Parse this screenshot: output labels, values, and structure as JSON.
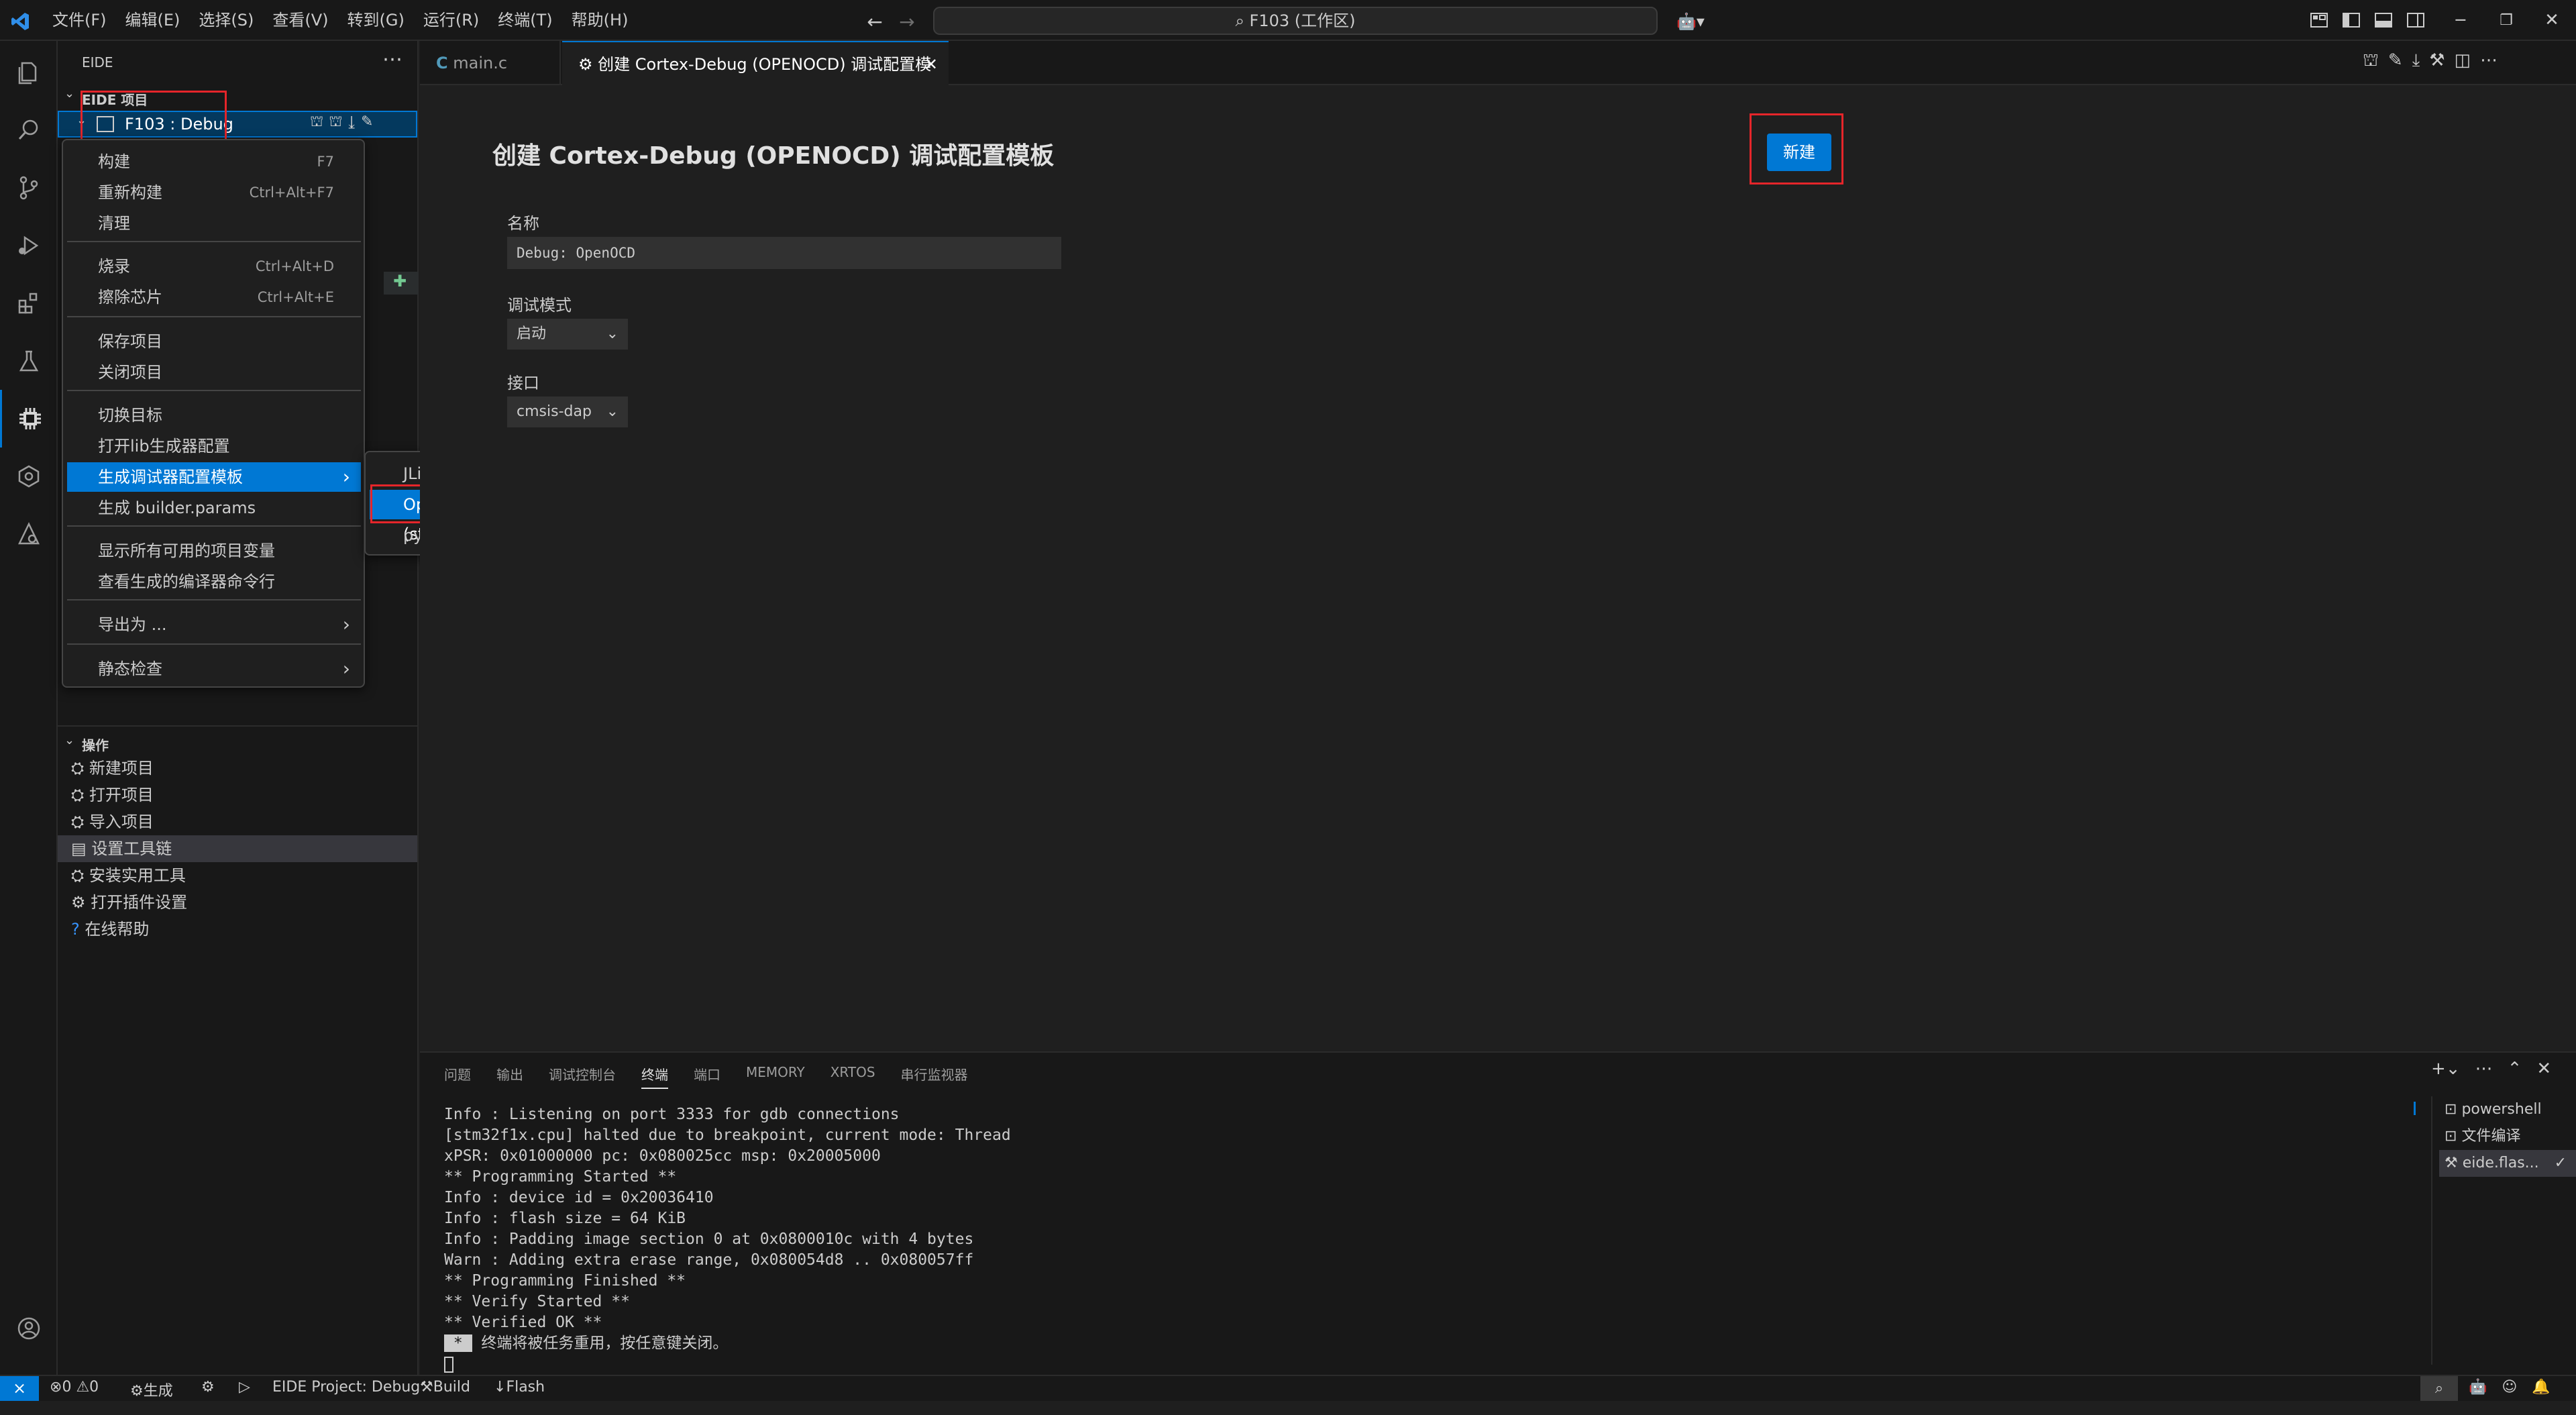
{
  "titlebar": {
    "menus": [
      "文件(F)",
      "编辑(E)",
      "选择(S)",
      "查看(V)",
      "转到(G)",
      "运行(R)",
      "终端(T)",
      "帮助(H)"
    ],
    "search_text": "F103 (工作区)"
  },
  "sidebar": {
    "view_title": "EIDE",
    "project_section": "EIDE 项目",
    "project_item": "F103 : Debug",
    "ops_section": "操作",
    "ops": [
      "新建项目",
      "打开项目",
      "导入项目",
      "设置工具链",
      "安装实用工具",
      "打开插件设置",
      "在线帮助"
    ]
  },
  "context_menu": {
    "items": [
      {
        "label": "构建",
        "key": "F7"
      },
      {
        "label": "重新构建",
        "key": "Ctrl+Alt+F7"
      },
      {
        "label": "清理",
        "key": ""
      },
      {
        "label": "烧录",
        "key": "Ctrl+Alt+D"
      },
      {
        "label": "擦除芯片",
        "key": "Ctrl+Alt+E"
      },
      {
        "label": "保存项目",
        "key": ""
      },
      {
        "label": "关闭项目",
        "key": ""
      },
      {
        "label": "切换目标",
        "key": ""
      },
      {
        "label": "打开lib生成器配置",
        "key": ""
      },
      {
        "label": "生成调试器配置模板",
        "key": ""
      },
      {
        "label": "生成 builder.params",
        "key": ""
      },
      {
        "label": "显示所有可用的项目变量",
        "key": ""
      },
      {
        "label": "查看生成的编译器命令行",
        "key": ""
      },
      {
        "label": "导出为 ...",
        "key": ""
      },
      {
        "label": "静态检查",
        "key": ""
      }
    ],
    "submenu": [
      "JLink",
      "OpenOCD (stlink,daplink...)",
      "pyOCD (daplink,stlink...)"
    ]
  },
  "tabs": [
    {
      "label": "main.c",
      "icon": "c-file-icon"
    },
    {
      "label": "创建 Cortex-Debug (OPENOCD) 调试配置模板",
      "icon": "gear-icon"
    }
  ],
  "editor": {
    "heading": "创建 Cortex-Debug (OPENOCD) 调试配置模板",
    "new_button": "新建",
    "name_label": "名称",
    "name_value": "Debug: OpenOCD",
    "mode_label": "调试模式",
    "mode_value": "启动",
    "iface_label": "接口",
    "iface_value": "cmsis-dap"
  },
  "panel": {
    "tabs": [
      "问题",
      "输出",
      "调试控制台",
      "终端",
      "端口",
      "MEMORY",
      "XRTOS",
      "串行监视器"
    ],
    "active_tab": "终端",
    "terminal_lines": [
      "Info : Listening on port 3333 for gdb connections",
      "[stm32f1x.cpu] halted due to breakpoint, current mode: Thread",
      "xPSR: 0x01000000 pc: 0x080025cc msp: 0x20005000",
      "** Programming Started **",
      "Info : device id = 0x20036410",
      "Info : flash size = 64 KiB",
      "Info : Padding image section 0 at 0x0800010c with 4 bytes",
      "Warn : Adding extra erase range, 0x080054d8 .. 0x080057ff",
      "** Programming Finished **",
      "** Verify Started **",
      "** Verified OK **"
    ],
    "terminal_notice": "终端将被任务重用，按任意键关闭。",
    "terminal_list": [
      "powershell",
      "文件编译",
      "eide.flas..."
    ]
  },
  "statusbar": {
    "errors": "0",
    "warnings": "0",
    "build_label": "生成",
    "project": "EIDE Project: Debug",
    "build": "Build",
    "flash": "Flash"
  },
  "colors": {
    "accent": "#0078d4",
    "redbox": "#e5252a",
    "bg": "#1f1f1f",
    "sidebar": "#181818"
  }
}
